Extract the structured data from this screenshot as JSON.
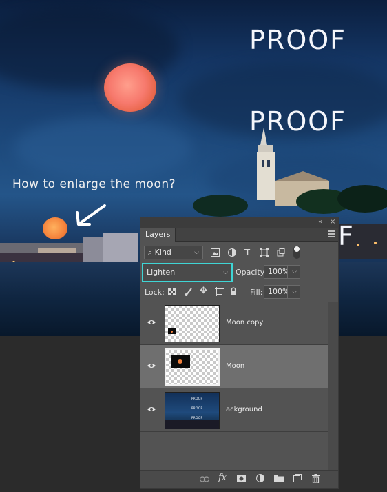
{
  "image": {
    "watermarks": [
      "PROOF",
      "PROOF"
    ],
    "edge_fragment": "F",
    "caption": "How to enlarge the moon?"
  },
  "panel": {
    "collapse_glyph": "«",
    "close_glyph": "×",
    "tab": "Layers",
    "filter": {
      "icon": "search-icon",
      "value": "Kind"
    },
    "blend_mode": "Lighten",
    "opacity_label": "Opacity:",
    "opacity_value": "100%",
    "lock_label": "Lock:",
    "fill_label": "Fill:",
    "fill_value": "100%",
    "layers": [
      {
        "name": "Moon copy",
        "selected": false
      },
      {
        "name": "Moon",
        "selected": true
      },
      {
        "name": "ackground",
        "selected": false
      }
    ],
    "bg_thumb_text": [
      "PROOF",
      "PROOF",
      "PROOF"
    ],
    "footer_icons": [
      "link-icon",
      "fx-icon",
      "mask-icon",
      "adjustment-icon",
      "folder-icon",
      "new-layer-icon",
      "trash-icon"
    ],
    "fx_label": "fx"
  },
  "colors": {
    "blend_highlight": "#3fd5d5",
    "panel_bg": "#535353",
    "selected_row": "#6f6f6f"
  }
}
